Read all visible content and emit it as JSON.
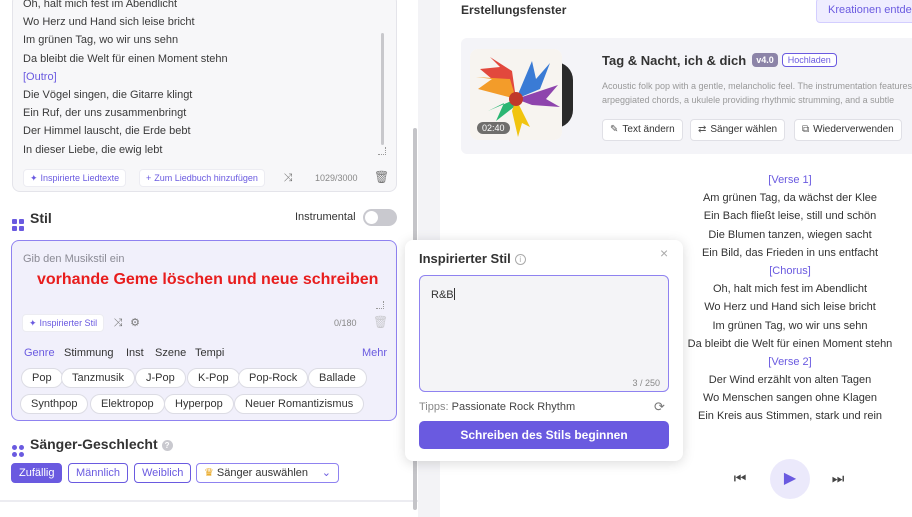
{
  "lyrics_editor": {
    "lines": [
      {
        "text": "Oh, halt mich fest im Abendlicht",
        "tag": false
      },
      {
        "text": "Wo Herz und Hand sich leise bricht",
        "tag": false
      },
      {
        "text": "Im grünen Tag, wo wir uns sehn",
        "tag": false
      },
      {
        "text": "Da bleibt die Welt für einen Moment stehn",
        "tag": false
      },
      {
        "text": "[Outro]",
        "tag": true
      },
      {
        "text": "Die Vögel singen, die Gitarre klingt",
        "tag": false
      },
      {
        "text": "Ein Ruf, der uns zusammenbringt",
        "tag": false
      },
      {
        "text": "Der Himmel lauscht, die Erde bebt",
        "tag": false
      },
      {
        "text": "In dieser Liebe, die ewig lebt",
        "tag": false
      }
    ],
    "inspire_label": "Inspirierte Liedtexte",
    "songbook_label": "Zum Liedbuch hinzufügen",
    "counter": "1029/3000"
  },
  "style_section": {
    "title": "Stil",
    "instrumental_label": "Instrumental",
    "placeholder": "Gib den Musikstil ein",
    "annotation": "vorhande Geme löschen und neue schreiben",
    "inspire_label": "Inspirierter Stil",
    "counter": "0/180",
    "categories": [
      "Genre",
      "Stimmung",
      "Inst",
      "Szene",
      "Tempi"
    ],
    "more_label": "Mehr",
    "genres": [
      "Pop",
      "Tanzmusik",
      "J-Pop",
      "K-Pop",
      "Pop-Rock",
      "Ballade",
      "Synthpop",
      "Elektropop",
      "Hyperpop",
      "Neuer Romantizismus"
    ]
  },
  "gender_section": {
    "title": "Sänger-Geschlecht",
    "help": "?",
    "options": [
      "Zufällig",
      "Männlich",
      "Weiblich"
    ],
    "select_label": "Sänger auswählen"
  },
  "creation_window": {
    "title": "Erstellungsfenster",
    "creations_button": "Kreationen entdecken",
    "song": {
      "title": "Tag & Nacht, ich & dich",
      "version": "v4.0",
      "upload_label": "Hochladen",
      "duration": "02:40",
      "description_1": "Acoustic folk pop with a gentle, melancholic feel. The instrumentation features",
      "description_2": "arpeggiated chords, a ukulele providing rhythmic strumming, and a subtle",
      "actions": [
        "Text ändern",
        "Sänger wählen",
        "Wiederverwenden"
      ]
    },
    "generated_lyrics": [
      {
        "text": "[Verse 1]",
        "tag": true
      },
      {
        "text": "Am grünen Tag, da wächst der Klee",
        "tag": false
      },
      {
        "text": "Ein Bach fließt leise, still und schön",
        "tag": false
      },
      {
        "text": "Die Blumen tanzen, wiegen sacht",
        "tag": false
      },
      {
        "text": "Ein Bild, das Frieden in uns entfacht",
        "tag": false
      },
      {
        "text": "[Chorus]",
        "tag": true
      },
      {
        "text": "Oh, halt mich fest im Abendlicht",
        "tag": false
      },
      {
        "text": "Wo Herz und Hand sich leise bricht",
        "tag": false
      },
      {
        "text": "Im grünen Tag, wo wir uns sehn",
        "tag": false
      },
      {
        "text": "Da bleibt die Welt für einen Moment stehn",
        "tag": false
      },
      {
        "text": "[Verse 2]",
        "tag": true
      },
      {
        "text": "Der Wind erzählt von alten Tagen",
        "tag": false
      },
      {
        "text": "Wo Menschen sangen ohne Klagen",
        "tag": false
      },
      {
        "text": "Ein Kreis aus Stimmen, stark und rein",
        "tag": false
      }
    ]
  },
  "inspired_style_popup": {
    "title": "Inspirierter Stil",
    "value": "R&B",
    "counter": "3 / 250",
    "tips_label": "Tipps:",
    "tips_value": "Passionate Rock Rhythm",
    "submit_label": "Schreiben des Stils beginnen"
  },
  "colors": {
    "accent": "#6a5ae0",
    "annotation": "#e81d1d"
  }
}
